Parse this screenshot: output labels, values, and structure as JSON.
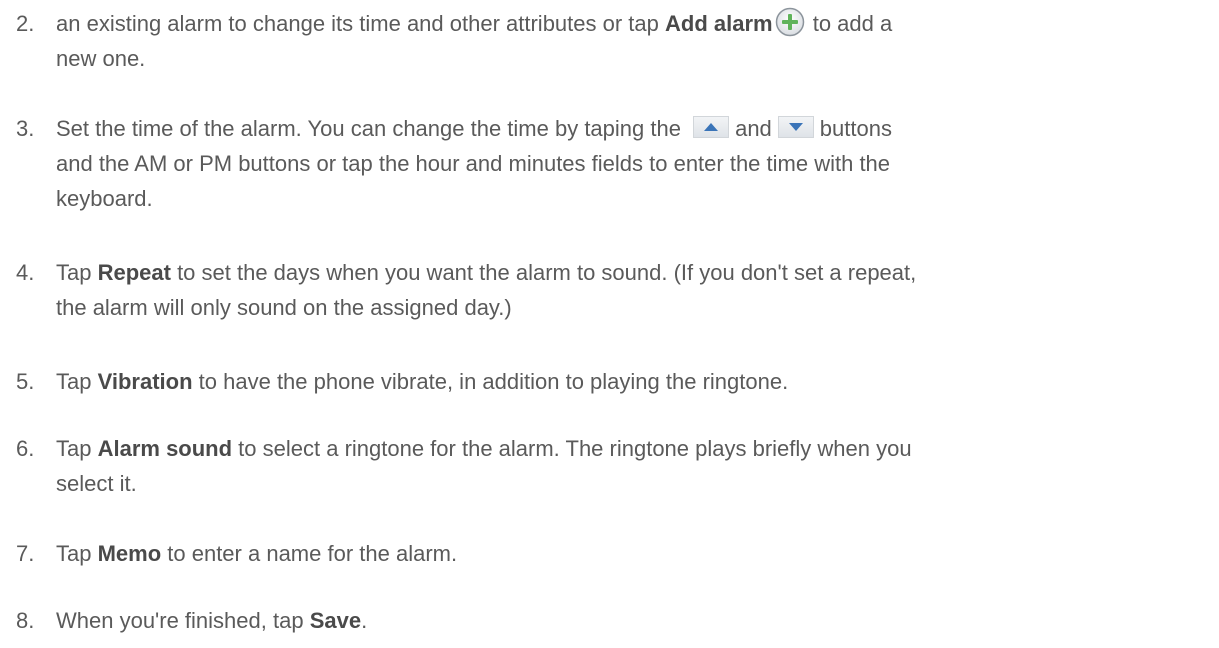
{
  "steps": [
    {
      "number": "2.",
      "lines": [
        {
          "t1": "an existing alarm to change its time and other attributes or tap ",
          "b1": "Add alarm",
          "icon": "add-circle-icon",
          "t2": " to add a"
        },
        {
          "t1": "new one."
        }
      ]
    },
    {
      "number": "3.",
      "lines": [
        {
          "t1": "Set the time of the alarm. You can change the time by taping the ",
          "icon1": "up-arrow-button-icon",
          "t2": "and",
          "icon2": "down-arrow-button-icon",
          "t3": "buttons"
        },
        {
          "t1": "and the AM or PM buttons or tap the hour and minutes fields to enter the time with the"
        },
        {
          "t1": "keyboard."
        }
      ]
    },
    {
      "number": "4.",
      "lines": [
        {
          "t1": "Tap ",
          "b1": "Repeat",
          "t2": " to set the days when you want the alarm to sound. (If you don't set a repeat,"
        },
        {
          "t1": "the alarm will only sound on the assigned day.)"
        }
      ]
    },
    {
      "number": "5.",
      "lines": [
        {
          "t1": "Tap ",
          "b1": "Vibration",
          "t2": " to have the phone vibrate, in addition to playing the ringtone."
        }
      ]
    },
    {
      "number": "6.",
      "lines": [
        {
          "t1": "Tap ",
          "b1": "Alarm sound",
          "t2": " to select a ringtone for the alarm. The ringtone plays briefly when you"
        },
        {
          "t1": "select it."
        }
      ]
    },
    {
      "number": "7.",
      "lines": [
        {
          "t1": "Tap ",
          "b1": "Memo",
          "t2": " to enter a name for the alarm."
        }
      ]
    },
    {
      "number": "8.",
      "lines": [
        {
          "t1": "When you're finished, tap ",
          "b1": "Save",
          "t2": "."
        }
      ]
    }
  ],
  "colors": {
    "text": "#5a5a5a",
    "icon_green": "#5fb35a",
    "arrow_blue": "#3a74b8"
  }
}
